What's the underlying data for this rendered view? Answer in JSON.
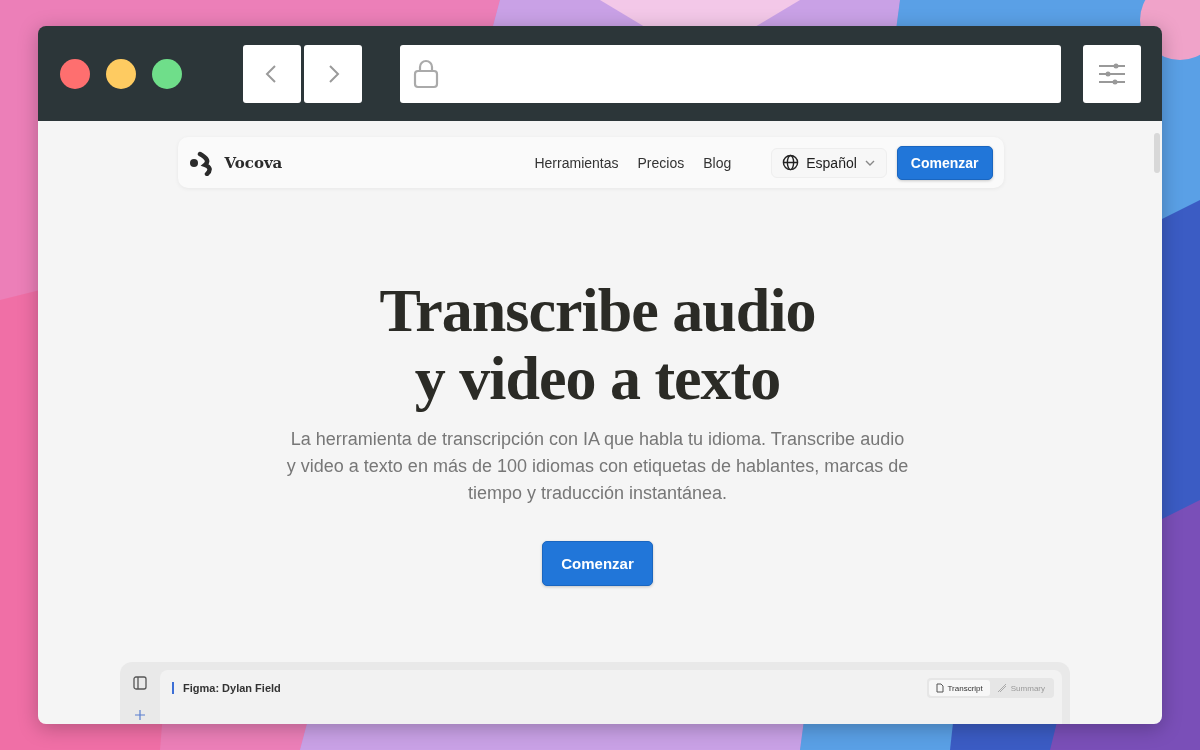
{
  "browser": {
    "nav_buttons": [
      {
        "kind": "back"
      },
      {
        "kind": "forward"
      }
    ]
  },
  "site_nav": {
    "brand": "Vocova",
    "links": [
      "Herramientas",
      "Precios",
      "Blog"
    ],
    "language": "Español",
    "cta": "Comenzar"
  },
  "hero": {
    "title_lines": [
      "Transcribe audio",
      "y video a texto"
    ],
    "subtitle": "La herramienta de transcripción con IA que habla tu idioma. Transcribe audio y video a texto en más de 100 idiomas con etiquetas de hablantes, marcas de tiempo y traducción instantánea.",
    "cta": "Comenzar"
  },
  "preview": {
    "title": "Figma: Dylan Field",
    "tabs": [
      {
        "label": "Transcript",
        "selected": true
      },
      {
        "label": "Summary",
        "selected": false
      }
    ]
  }
}
